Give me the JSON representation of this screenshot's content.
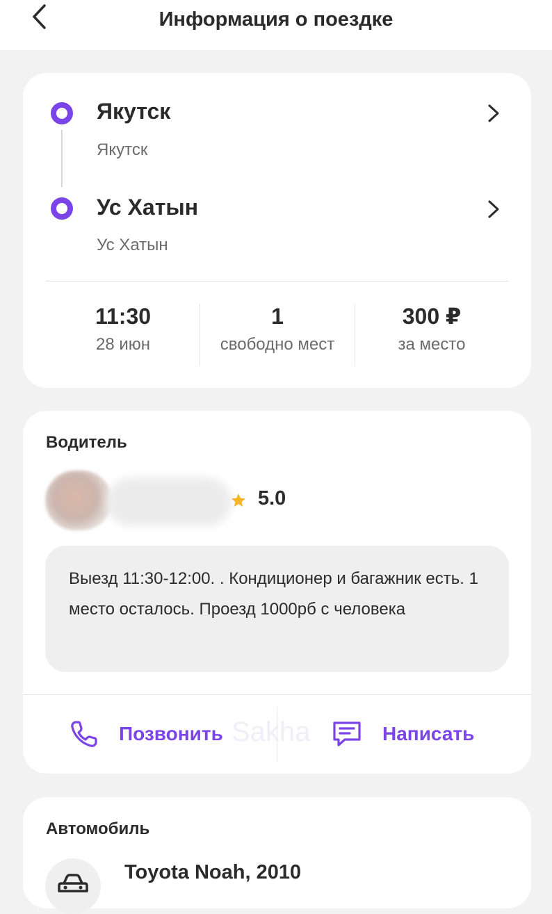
{
  "header": {
    "title": "Информация о поездке"
  },
  "route": {
    "from": {
      "title": "Якутск",
      "subtitle": "Якутск"
    },
    "to": {
      "title": "Ус Хатын",
      "subtitle": "Ус Хатын"
    },
    "stats": [
      {
        "value": "11:30",
        "label": "28 июн"
      },
      {
        "value": "1",
        "label": "свободно мест"
      },
      {
        "value": "300 ₽",
        "label": "за место"
      }
    ],
    "accent_color": "#7b44e6"
  },
  "driver": {
    "section_title": "Водитель",
    "rating": "5.0",
    "comment": "Выезд 11:30-12:00. . Кондиционер и багажник есть. 1 место осталось. Проезд 1000рб с человека",
    "call_label": "Позвонить",
    "message_label": "Написать",
    "watermark": "Sakha"
  },
  "car": {
    "section_title": "Автомобиль",
    "model": "Toyota Noah, 2010"
  }
}
